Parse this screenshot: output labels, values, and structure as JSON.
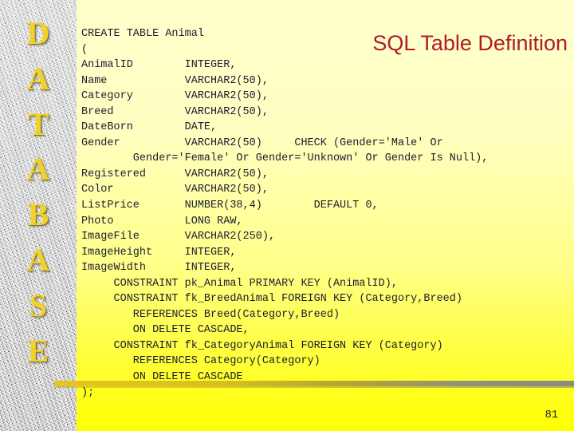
{
  "slide": {
    "title": "SQL Table Definition",
    "page_number": "81",
    "accent_colors": {
      "title_red": "#b21a2e",
      "sidebar_letter_yellow": "#f2d228",
      "background_top": "#ffffcc",
      "background_bottom": "#ffff00",
      "code_text": "#1c1c32",
      "rule_gold": "#e5c41e",
      "rule_gray": "#8a8a80"
    }
  },
  "sidebar": {
    "vertical_word": "DATABASE",
    "letters": [
      "D",
      "A",
      "T",
      "A",
      "B",
      "A",
      "S",
      "E"
    ]
  },
  "code": {
    "language": "sql",
    "lines": [
      "CREATE TABLE Animal",
      "(",
      "AnimalID        INTEGER,",
      "Name            VARCHAR2(50),",
      "Category        VARCHAR2(50),",
      "Breed           VARCHAR2(50),",
      "DateBorn        DATE,",
      "Gender          VARCHAR2(50)     CHECK (Gender='Male' Or",
      "        Gender='Female' Or Gender='Unknown' Or Gender Is Null),",
      "Registered      VARCHAR2(50),",
      "Color           VARCHAR2(50),",
      "ListPrice       NUMBER(38,4)        DEFAULT 0,",
      "Photo           LONG RAW,",
      "ImageFile       VARCHAR2(250),",
      "ImageHeight     INTEGER,",
      "ImageWidth      INTEGER,",
      "     CONSTRAINT pk_Animal PRIMARY KEY (AnimalID),",
      "     CONSTRAINT fk_BreedAnimal FOREIGN KEY (Category,Breed)",
      "        REFERENCES Breed(Category,Breed)",
      "        ON DELETE CASCADE,",
      "     CONSTRAINT fk_CategoryAnimal FOREIGN KEY (Category)",
      "        REFERENCES Category(Category)",
      "        ON DELETE CASCADE",
      ");"
    ]
  }
}
